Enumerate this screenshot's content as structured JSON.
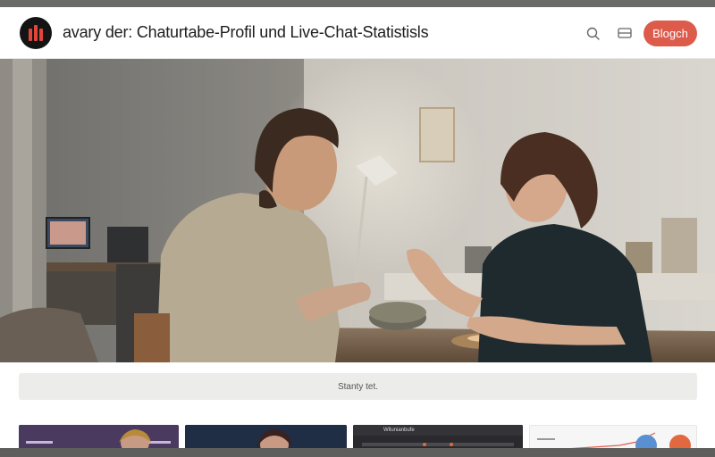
{
  "header": {
    "title": "avary der: Chaturtabe-Profil und Live-Chat-Statistisls",
    "blog_button_label": "Blogch",
    "icons": [
      "logo-icon",
      "search-icon",
      "menu-icon"
    ]
  },
  "hero": {
    "image_subject": "two-people-chatting-at-table"
  },
  "status_bar": {
    "text": "Stanty tet."
  },
  "cards": [
    {
      "label": ""
    },
    {
      "label": ""
    },
    {
      "label": "Wllunianbufe"
    },
    {
      "label": ""
    }
  ],
  "colors": {
    "accent": "#dd5b4a",
    "logo_bg": "#141414",
    "logo_mark": "#e2453a"
  }
}
